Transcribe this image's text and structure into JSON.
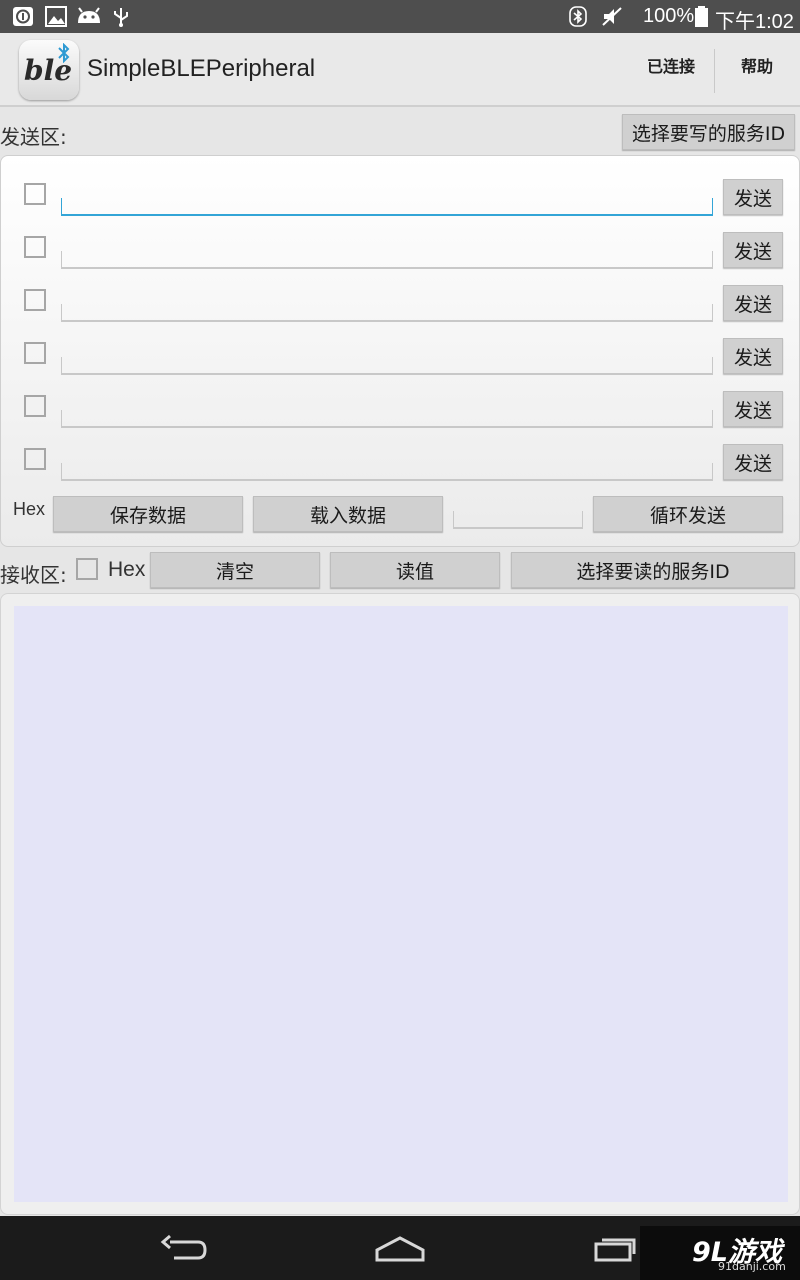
{
  "status_bar": {
    "battery": "100%",
    "time": "下午1:02",
    "icons": [
      "info-icon",
      "image-icon",
      "android-icon",
      "usb-icon",
      "bluetooth-icon",
      "mute-icon",
      "battery-icon"
    ]
  },
  "action_bar": {
    "title": "SimpleBLEPeripheral",
    "logo_text": "ble",
    "connected_label": "已连接",
    "help_label": "帮助"
  },
  "send_section": {
    "label": "发送区:",
    "select_write_service": "选择要写的服务ID",
    "rows": [
      {
        "value": "",
        "checked": false,
        "send_label": "发送"
      },
      {
        "value": "",
        "checked": false,
        "send_label": "发送"
      },
      {
        "value": "",
        "checked": false,
        "send_label": "发送"
      },
      {
        "value": "",
        "checked": false,
        "send_label": "发送"
      },
      {
        "value": "",
        "checked": false,
        "send_label": "发送"
      },
      {
        "value": "",
        "checked": false,
        "send_label": "发送"
      }
    ],
    "hex_label": "Hex",
    "save_data": "保存数据",
    "load_data": "载入数据",
    "interval_value": "",
    "loop_send": "循环发送"
  },
  "receive_section": {
    "label": "接收区:",
    "hex_label": "Hex",
    "clear": "清空",
    "read_value": "读值",
    "select_read_service": "选择要读的服务ID",
    "content": ""
  },
  "watermark": {
    "text": "9L游戏",
    "sub": "91danji.com"
  },
  "colors": {
    "focus_accent": "#33a5d7",
    "receive_area_bg": "#e4e4f7",
    "status_bar_bg": "#4e4e4e",
    "nav_bar_bg": "#1b1b1b"
  }
}
